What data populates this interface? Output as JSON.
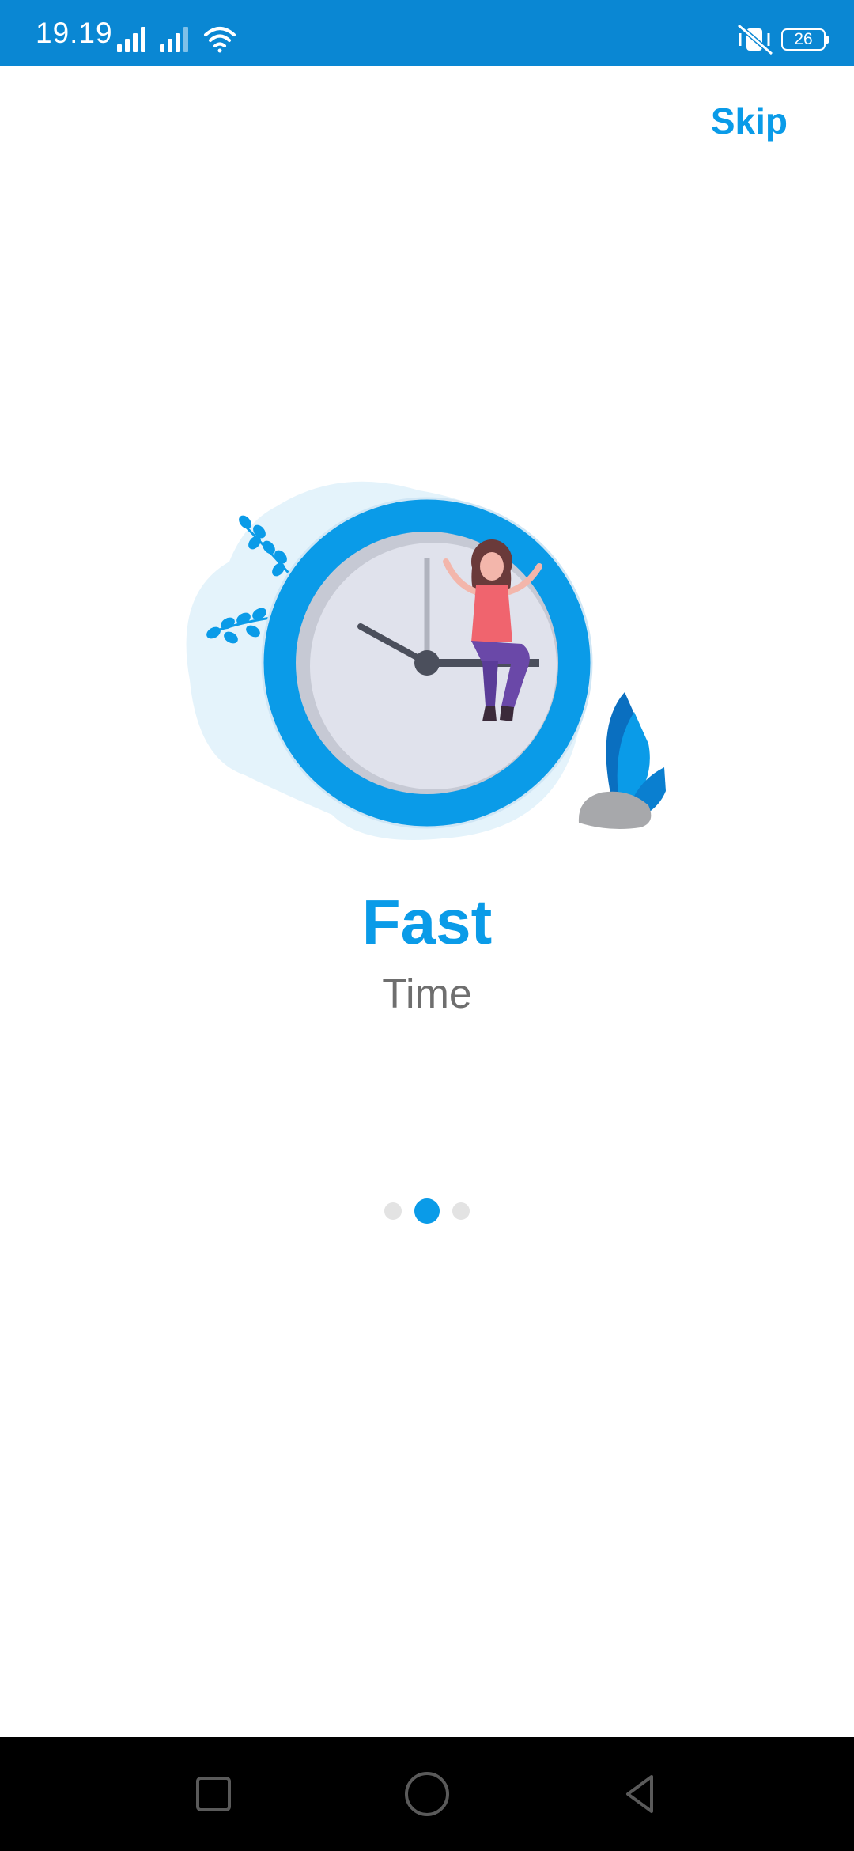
{
  "status_bar": {
    "time": "19.19",
    "battery_level": "26",
    "background_color": "#0a87d3"
  },
  "onboarding": {
    "skip_label": "Skip",
    "title": "Fast",
    "subtitle": "Time",
    "page_count": 3,
    "active_page_index": 1,
    "accent_color": "#0a9be8"
  },
  "illustration": {
    "icon": "clock-woman-illustration"
  },
  "nav_bar": {
    "recent_icon": "square-icon",
    "home_icon": "circle-icon",
    "back_icon": "triangle-back-icon"
  }
}
